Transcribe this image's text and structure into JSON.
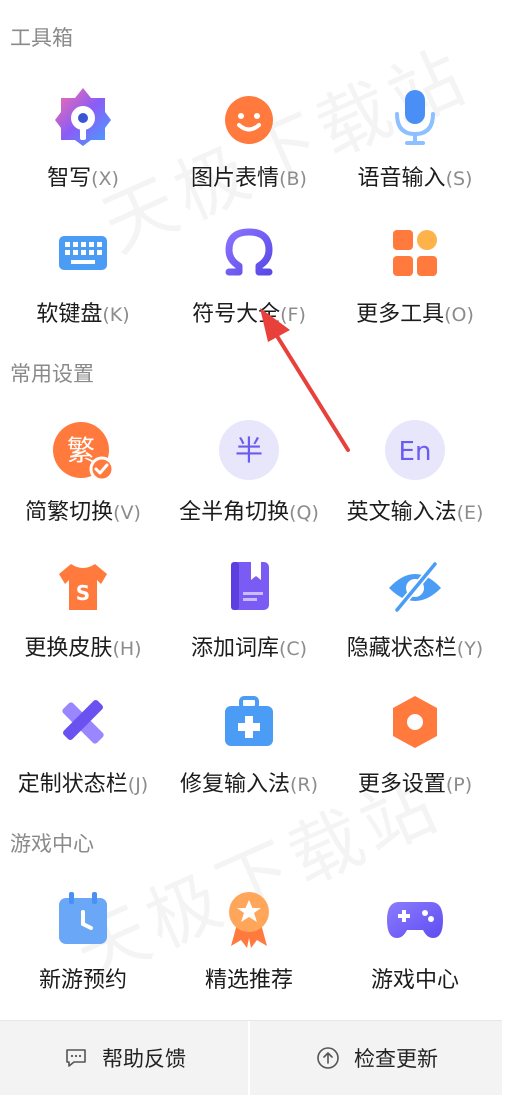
{
  "watermark": "天极下载站",
  "sections": [
    {
      "title": "工具箱",
      "items": [
        {
          "label": "智写",
          "key": "(X)",
          "icon": "smart-write-icon"
        },
        {
          "label": "图片表情",
          "key": "(B)",
          "icon": "emoji-icon"
        },
        {
          "label": "语音输入",
          "key": "(S)",
          "icon": "microphone-icon"
        },
        {
          "label": "软键盘",
          "key": "(K)",
          "icon": "keyboard-icon"
        },
        {
          "label": "符号大全",
          "key": "(F)",
          "icon": "omega-icon"
        },
        {
          "label": "更多工具",
          "key": "(O)",
          "icon": "grid-icon"
        }
      ]
    },
    {
      "title": "常用设置",
      "items": [
        {
          "label": "简繁切换",
          "key": "(V)",
          "icon": "traditional-chinese-icon",
          "glyph": "繁"
        },
        {
          "label": "全半角切换",
          "key": "(Q)",
          "icon": "half-width-icon",
          "glyph": "半"
        },
        {
          "label": "英文输入法",
          "key": "(E)",
          "icon": "english-icon",
          "glyph": "En"
        },
        {
          "label": "更换皮肤",
          "key": "(H)",
          "icon": "tshirt-icon"
        },
        {
          "label": "添加词库",
          "key": "(C)",
          "icon": "dictionary-icon"
        },
        {
          "label": "隐藏状态栏",
          "key": "(Y)",
          "icon": "eye-hidden-icon"
        },
        {
          "label": "定制状态栏",
          "key": "(J)",
          "icon": "ruler-pencil-icon"
        },
        {
          "label": "修复输入法",
          "key": "(R)",
          "icon": "repair-kit-icon"
        },
        {
          "label": "更多设置",
          "key": "(P)",
          "icon": "gear-icon"
        }
      ]
    },
    {
      "title": "游戏中心",
      "items": [
        {
          "label": "新游预约",
          "key": "",
          "icon": "calendar-clock-icon"
        },
        {
          "label": "精选推荐",
          "key": "",
          "icon": "medal-icon"
        },
        {
          "label": "游戏中心",
          "key": "",
          "icon": "gamepad-icon"
        }
      ]
    }
  ],
  "footer": {
    "help_label": "帮助反馈",
    "update_label": "检查更新"
  },
  "colors": {
    "orange": "#ff7a3c",
    "blue": "#4a8ff5",
    "purple": "#7060f0",
    "accent_red": "#e8403a",
    "section_title": "#8a8a8a"
  }
}
